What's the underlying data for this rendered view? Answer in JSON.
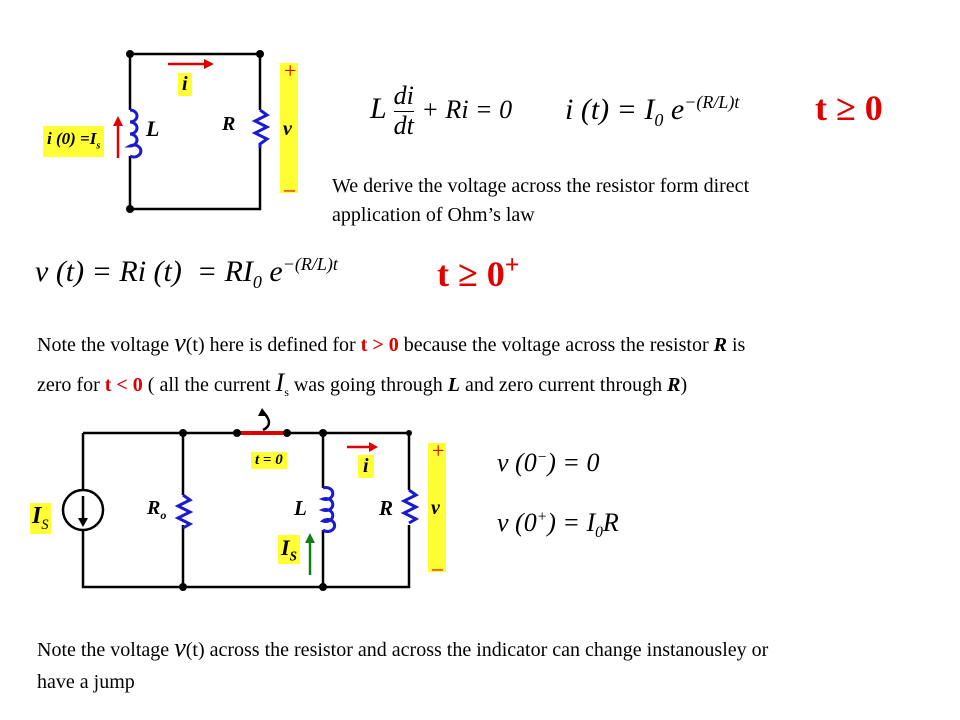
{
  "top_circuit": {
    "inductor_label": "L",
    "resistor_label": "R",
    "current_label": "i",
    "voltage_label": "v",
    "plus": "+",
    "minus": "–",
    "initial_current": "i (0) =I",
    "initial_current_sub": "s"
  },
  "equations": {
    "diff_eq": {
      "L": "L",
      "num": "di",
      "den": "dt",
      "rest": "+ Ri = 0"
    },
    "solution": {
      "lhs": "i (t) = I",
      "sub": "0",
      "e": "e",
      "exp": "−(R/L)t"
    },
    "condition1": "t ≥ 0",
    "voltage": {
      "lhs": "v (t) = Ri (t)",
      "mid": "= RI",
      "sub": "0",
      "e": "e",
      "exp": "−(R/L)t"
    },
    "condition2": "t ≥ 0",
    "condition2_sup": "+",
    "v0_minus": {
      "lhs": "v (0",
      "sup": "−",
      "rhs": ") = 0"
    },
    "v0_plus": {
      "lhs": "v (0",
      "sup": "+",
      "rhs": ") = I",
      "sub": "0",
      "tail": "R"
    }
  },
  "paragraph1": {
    "line1": "We derive the voltage across the resistor form direct",
    "line2": "application of Ohm’s law"
  },
  "note1": {
    "a": "Note the voltage ",
    "v": "v",
    "b": "(t)  here is defined for ",
    "cond1": "t > 0",
    "c": " because the voltage across the resistor ",
    "R": "R",
    "d": " is",
    "e": "zero for ",
    "cond2": "t < 0",
    "f": " ( all the current ",
    "Is": "I",
    "Is_sub": "s",
    "g": " was going through ",
    "L": "L",
    "h": " and zero current through ",
    "R2": "R",
    "i": ")"
  },
  "bottom_circuit": {
    "source_label": "I",
    "source_sub": "S",
    "ro_label": "R",
    "ro_sub": "o",
    "switch_label": "t = 0",
    "inductor_label": "L",
    "resistor_label": "R",
    "current_label": "i",
    "voltage_label": "v",
    "plus": "+",
    "minus": "–",
    "inductor_current": "I",
    "inductor_current_sub": "S"
  },
  "note2": {
    "a": "Note the voltage ",
    "v": "v",
    "b": "(t) across the resistor and across the indicator can change instanousley or",
    "line2": "have a jump"
  },
  "colors": {
    "accent_red": "#e00000",
    "highlight": "#ffff33",
    "component_blue": "#1a1ad0",
    "arrow_green": "#108010"
  }
}
